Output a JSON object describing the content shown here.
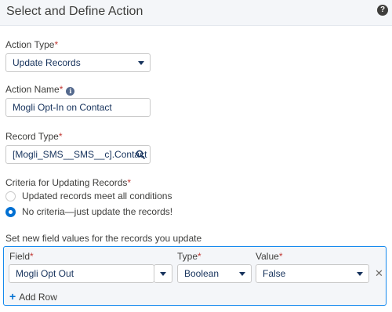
{
  "header": {
    "title": "Select and Define Action",
    "help_icon": "?"
  },
  "action_type": {
    "label": "Action Type",
    "value": "Update Records"
  },
  "action_name": {
    "label": "Action Name",
    "value": "Mogli Opt-In on Contact",
    "info_icon": "i"
  },
  "record_type": {
    "label": "Record Type",
    "value": "[Mogli_SMS__SMS__c].Contact"
  },
  "criteria": {
    "label": "Criteria for Updating Records",
    "options": [
      {
        "label": "Updated records meet all conditions",
        "selected": false
      },
      {
        "label": "No criteria—just update the records!",
        "selected": true
      }
    ]
  },
  "field_values": {
    "label": "Set new field values for the records you update",
    "columns": {
      "field": "Field",
      "type": "Type",
      "value": "Value"
    },
    "rows": [
      {
        "field": "Mogli Opt Out",
        "type": "Boolean",
        "value": "False"
      }
    ],
    "add_row_label": "Add Row"
  },
  "required_marker": "*",
  "colors": {
    "accent": "#0070d2",
    "required": "#c23934",
    "focus_border": "#1589ee",
    "header_bg": "#f4f6f9"
  }
}
